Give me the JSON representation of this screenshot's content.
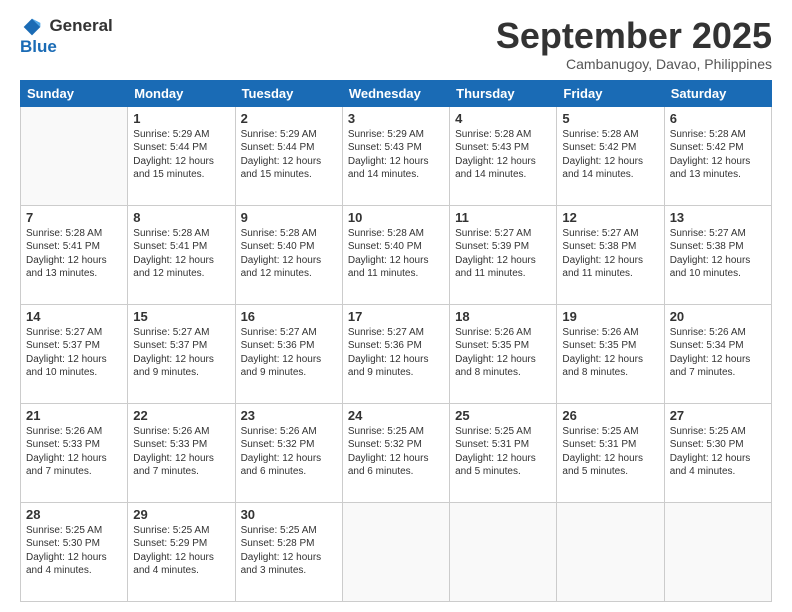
{
  "logo": {
    "line1": "General",
    "line2": "Blue"
  },
  "title": "September 2025",
  "location": "Cambanugoy, Davao, Philippines",
  "days_of_week": [
    "Sunday",
    "Monday",
    "Tuesday",
    "Wednesday",
    "Thursday",
    "Friday",
    "Saturday"
  ],
  "weeks": [
    [
      {
        "day": "",
        "info": ""
      },
      {
        "day": "1",
        "info": "Sunrise: 5:29 AM\nSunset: 5:44 PM\nDaylight: 12 hours\nand 15 minutes."
      },
      {
        "day": "2",
        "info": "Sunrise: 5:29 AM\nSunset: 5:44 PM\nDaylight: 12 hours\nand 15 minutes."
      },
      {
        "day": "3",
        "info": "Sunrise: 5:29 AM\nSunset: 5:43 PM\nDaylight: 12 hours\nand 14 minutes."
      },
      {
        "day": "4",
        "info": "Sunrise: 5:28 AM\nSunset: 5:43 PM\nDaylight: 12 hours\nand 14 minutes."
      },
      {
        "day": "5",
        "info": "Sunrise: 5:28 AM\nSunset: 5:42 PM\nDaylight: 12 hours\nand 14 minutes."
      },
      {
        "day": "6",
        "info": "Sunrise: 5:28 AM\nSunset: 5:42 PM\nDaylight: 12 hours\nand 13 minutes."
      }
    ],
    [
      {
        "day": "7",
        "info": "Sunrise: 5:28 AM\nSunset: 5:41 PM\nDaylight: 12 hours\nand 13 minutes."
      },
      {
        "day": "8",
        "info": "Sunrise: 5:28 AM\nSunset: 5:41 PM\nDaylight: 12 hours\nand 12 minutes."
      },
      {
        "day": "9",
        "info": "Sunrise: 5:28 AM\nSunset: 5:40 PM\nDaylight: 12 hours\nand 12 minutes."
      },
      {
        "day": "10",
        "info": "Sunrise: 5:28 AM\nSunset: 5:40 PM\nDaylight: 12 hours\nand 11 minutes."
      },
      {
        "day": "11",
        "info": "Sunrise: 5:27 AM\nSunset: 5:39 PM\nDaylight: 12 hours\nand 11 minutes."
      },
      {
        "day": "12",
        "info": "Sunrise: 5:27 AM\nSunset: 5:38 PM\nDaylight: 12 hours\nand 11 minutes."
      },
      {
        "day": "13",
        "info": "Sunrise: 5:27 AM\nSunset: 5:38 PM\nDaylight: 12 hours\nand 10 minutes."
      }
    ],
    [
      {
        "day": "14",
        "info": "Sunrise: 5:27 AM\nSunset: 5:37 PM\nDaylight: 12 hours\nand 10 minutes."
      },
      {
        "day": "15",
        "info": "Sunrise: 5:27 AM\nSunset: 5:37 PM\nDaylight: 12 hours\nand 9 minutes."
      },
      {
        "day": "16",
        "info": "Sunrise: 5:27 AM\nSunset: 5:36 PM\nDaylight: 12 hours\nand 9 minutes."
      },
      {
        "day": "17",
        "info": "Sunrise: 5:27 AM\nSunset: 5:36 PM\nDaylight: 12 hours\nand 9 minutes."
      },
      {
        "day": "18",
        "info": "Sunrise: 5:26 AM\nSunset: 5:35 PM\nDaylight: 12 hours\nand 8 minutes."
      },
      {
        "day": "19",
        "info": "Sunrise: 5:26 AM\nSunset: 5:35 PM\nDaylight: 12 hours\nand 8 minutes."
      },
      {
        "day": "20",
        "info": "Sunrise: 5:26 AM\nSunset: 5:34 PM\nDaylight: 12 hours\nand 7 minutes."
      }
    ],
    [
      {
        "day": "21",
        "info": "Sunrise: 5:26 AM\nSunset: 5:33 PM\nDaylight: 12 hours\nand 7 minutes."
      },
      {
        "day": "22",
        "info": "Sunrise: 5:26 AM\nSunset: 5:33 PM\nDaylight: 12 hours\nand 7 minutes."
      },
      {
        "day": "23",
        "info": "Sunrise: 5:26 AM\nSunset: 5:32 PM\nDaylight: 12 hours\nand 6 minutes."
      },
      {
        "day": "24",
        "info": "Sunrise: 5:25 AM\nSunset: 5:32 PM\nDaylight: 12 hours\nand 6 minutes."
      },
      {
        "day": "25",
        "info": "Sunrise: 5:25 AM\nSunset: 5:31 PM\nDaylight: 12 hours\nand 5 minutes."
      },
      {
        "day": "26",
        "info": "Sunrise: 5:25 AM\nSunset: 5:31 PM\nDaylight: 12 hours\nand 5 minutes."
      },
      {
        "day": "27",
        "info": "Sunrise: 5:25 AM\nSunset: 5:30 PM\nDaylight: 12 hours\nand 4 minutes."
      }
    ],
    [
      {
        "day": "28",
        "info": "Sunrise: 5:25 AM\nSunset: 5:30 PM\nDaylight: 12 hours\nand 4 minutes."
      },
      {
        "day": "29",
        "info": "Sunrise: 5:25 AM\nSunset: 5:29 PM\nDaylight: 12 hours\nand 4 minutes."
      },
      {
        "day": "30",
        "info": "Sunrise: 5:25 AM\nSunset: 5:28 PM\nDaylight: 12 hours\nand 3 minutes."
      },
      {
        "day": "",
        "info": ""
      },
      {
        "day": "",
        "info": ""
      },
      {
        "day": "",
        "info": ""
      },
      {
        "day": "",
        "info": ""
      }
    ]
  ]
}
